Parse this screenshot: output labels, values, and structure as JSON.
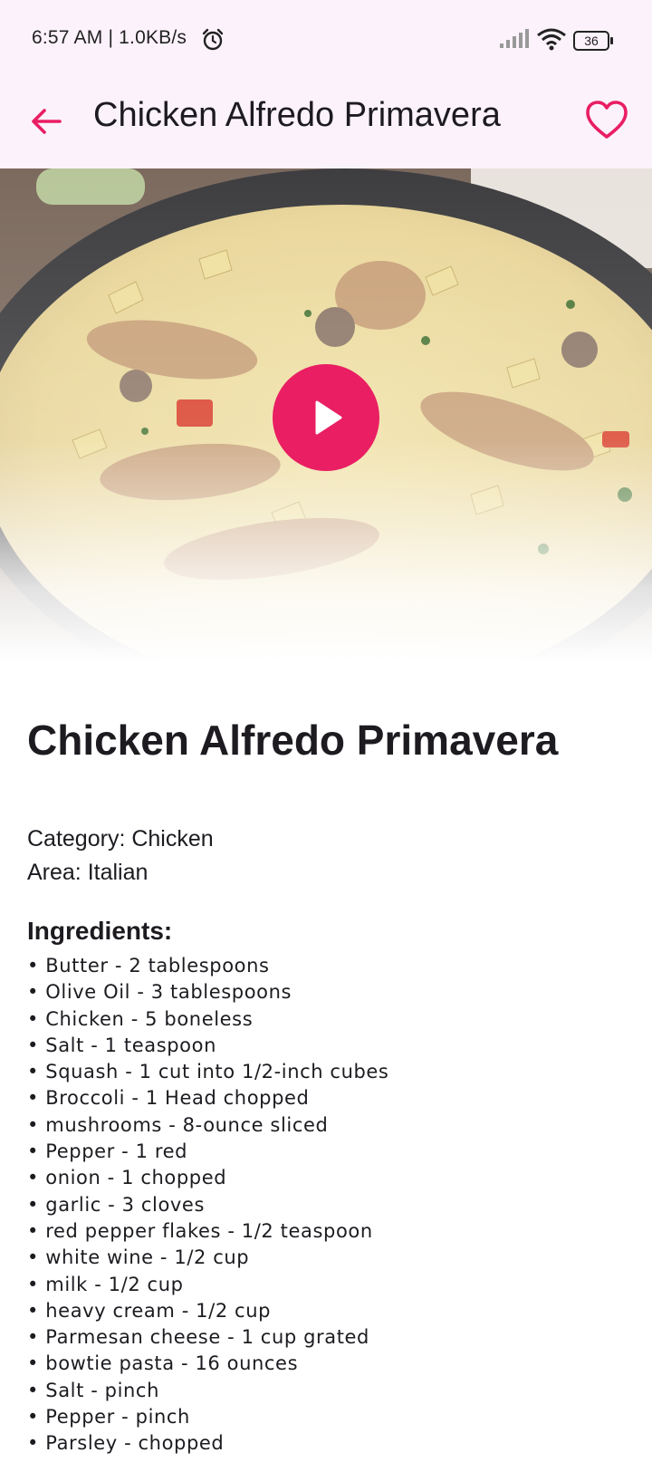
{
  "status_bar": {
    "time": "6:57 AM | 1.0KB/s",
    "battery": "36",
    "icons": [
      "alarm-icon",
      "signal-icon",
      "wifi-icon",
      "battery-icon"
    ]
  },
  "app_bar": {
    "title": "Chicken Alfredo Primavera",
    "back_icon": "arrow-left-icon",
    "favorite_icon": "heart-outline-icon"
  },
  "hero": {
    "play_icon": "play-icon"
  },
  "recipe": {
    "title": "Chicken Alfredo Primavera",
    "category": "Category: Chicken",
    "area": "Area: Italian",
    "ingredients_title": "Ingredients:",
    "ingredients": [
      "• Butter - 2 tablespoons",
      "• Olive Oil - 3 tablespoons",
      "• Chicken - 5 boneless",
      "• Salt - 1 teaspoon",
      "• Squash - 1 cut into 1/2-inch cubes",
      "• Broccoli - 1 Head chopped",
      "• mushrooms - 8-ounce sliced",
      "• Pepper - 1 red",
      "• onion - 1 chopped",
      "• garlic - 3 cloves",
      "• red pepper flakes - 1/2 teaspoon",
      "• white wine - 1/2 cup",
      "• milk - 1/2 cup",
      "• heavy cream - 1/2 cup",
      "• Parmesan cheese - 1 cup grated",
      "• bowtie pasta - 16 ounces",
      "• Salt - pinch",
      "• Pepper - pinch",
      "• Parsley - chopped"
    ]
  },
  "colors": {
    "accent": "#e91e63",
    "app_bar_bg": "#fcf2fb",
    "text": "#1d1b20"
  }
}
